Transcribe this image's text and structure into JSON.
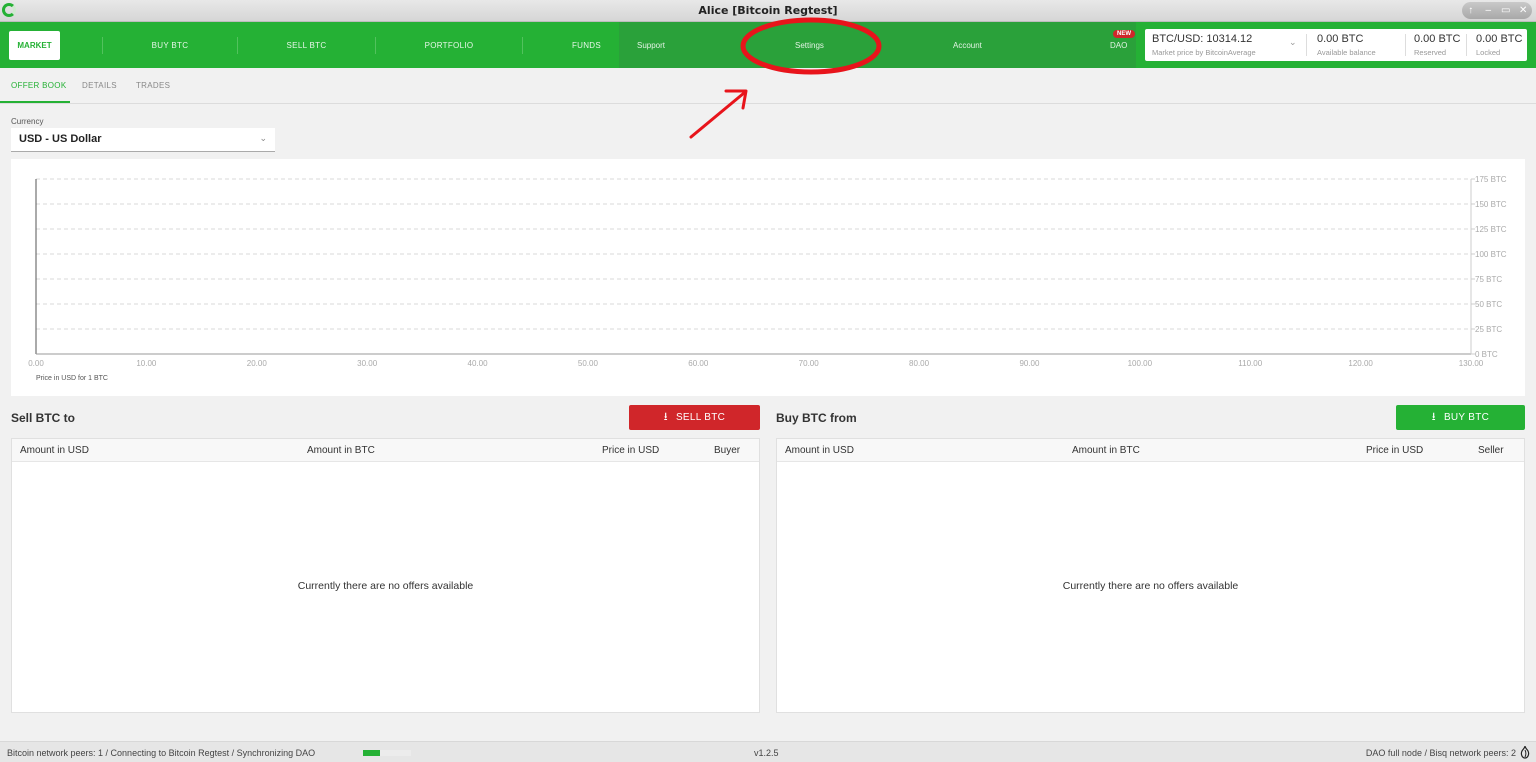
{
  "window": {
    "title": "Alice [Bitcoin Regtest]",
    "controls": [
      "↑",
      "–",
      "▭",
      "✕"
    ]
  },
  "nav": {
    "market": "MARKET",
    "buy_btc": "BUY BTC",
    "sell_btc": "SELL BTC",
    "portfolio": "PORTFOLIO",
    "funds": "FUNDS",
    "support": "Support",
    "settings": "Settings",
    "account": "Account",
    "dao": "DAO",
    "dao_badge": "NEW"
  },
  "balances": {
    "price_value": "BTC/USD: 10314.12",
    "price_label": "Market price by BitcoinAverage",
    "available_value": "0.00 BTC",
    "available_label": "Available balance",
    "reserved_value": "0.00 BTC",
    "reserved_label": "Reserved",
    "locked_value": "0.00 BTC",
    "locked_label": "Locked"
  },
  "tabs": {
    "offer_book": "OFFER BOOK",
    "details": "DETAILS",
    "trades": "TRADES",
    "active": "offer_book"
  },
  "currency": {
    "label": "Currency",
    "value": "USD  -  US Dollar"
  },
  "chart_data": {
    "type": "area",
    "title": "",
    "xlabel": "Price in USD for 1 BTC",
    "ylabel": "",
    "xlim": [
      0,
      130
    ],
    "ylim": [
      0,
      175
    ],
    "x_ticks": [
      "0.00",
      "10.00",
      "20.00",
      "30.00",
      "40.00",
      "50.00",
      "60.00",
      "70.00",
      "80.00",
      "90.00",
      "100.00",
      "110.00",
      "120.00",
      "130.00"
    ],
    "y_ticks": [
      "0 BTC",
      "25 BTC",
      "50 BTC",
      "75 BTC",
      "100 BTC",
      "125 BTC",
      "150 BTC",
      "175 BTC"
    ],
    "grid": true,
    "series": []
  },
  "sell_section": {
    "title": "Sell BTC to",
    "button": "SELL BTC",
    "columns": [
      "Amount in USD",
      "Amount in BTC",
      "Price in USD",
      "Buyer"
    ],
    "empty_message": "Currently there are no offers available"
  },
  "buy_section": {
    "title": "Buy BTC from",
    "button": "BUY BTC",
    "columns": [
      "Amount in USD",
      "Amount in BTC",
      "Price in USD",
      "Seller"
    ],
    "empty_message": "Currently there are no offers available"
  },
  "footer": {
    "status": "Bitcoin network peers: 1 / Connecting to Bitcoin Regtest / Synchronizing DAO",
    "sync_progress": 0.35,
    "version": "v1.2.5",
    "network": "DAO full node / Bisq network peers: 2"
  },
  "colors": {
    "accent": "#25b135",
    "sell": "#d0262a",
    "annotation": "#e8141b"
  }
}
